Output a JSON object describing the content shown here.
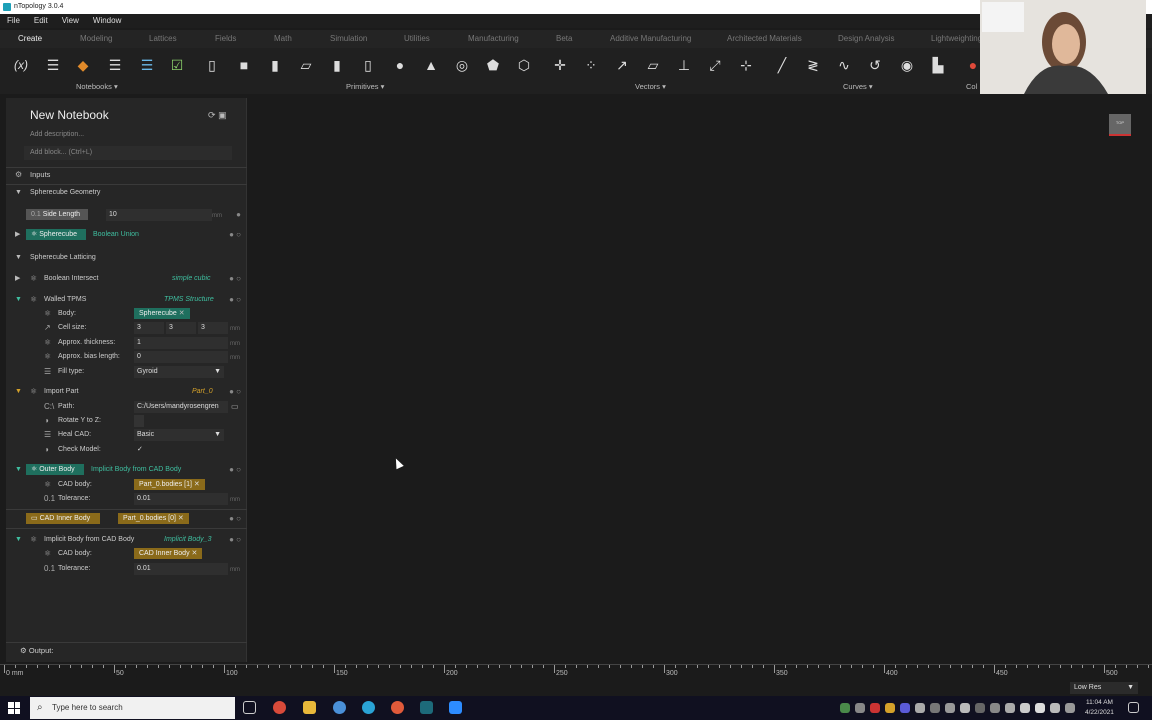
{
  "window": {
    "title": "nTopology 3.0.4"
  },
  "menu": [
    "File",
    "Edit",
    "View",
    "Window"
  ],
  "tabs": [
    "Create",
    "Modeling",
    "Lattices",
    "Fields",
    "Math",
    "Simulation",
    "Utilities",
    "Manufacturing",
    "Beta",
    "Additive Manufacturing",
    "Architected Materials",
    "Design Analysis",
    "Lightweighting"
  ],
  "ribbon": {
    "groups": [
      "Notebooks",
      "Primitives",
      "Vectors",
      "Curves",
      "Col"
    ],
    "fx_label": "(x)"
  },
  "notebook": {
    "title": "New Notebook",
    "description_placeholder": "Add description...",
    "add_block_placeholder": "Add block... (Ctrl+L)",
    "inputs_label": "Inputs",
    "output_label": "Output:"
  },
  "sections": {
    "geometry": {
      "title": "Spherecube Geometry",
      "side_length": {
        "label": "Side Length",
        "value": "10",
        "unit": "mm"
      },
      "spherecube": {
        "label": "Spherecube",
        "type": "Boolean Union"
      }
    },
    "latticing": {
      "title": "Spherecube Latticing",
      "boolean_intersect": {
        "label": "Boolean Intersect",
        "subtitle": "simple cubic"
      },
      "walled_tpms": {
        "label": "Walled TPMS",
        "subtitle": "TPMS Structure",
        "body_label": "Body:",
        "body_value": "Spherecube",
        "cell_size_label": "Cell size:",
        "cell_size": [
          "3",
          "3",
          "3"
        ],
        "cell_unit": "mm",
        "thickness_label": "Approx. thickness:",
        "thickness": "1",
        "bias_label": "Approx. bias length:",
        "bias": "0",
        "fill_label": "Fill type:",
        "fill": "Gyroid",
        "unit": "mm"
      },
      "import_part": {
        "label": "Import Part",
        "subtitle": "Part_0",
        "path_label": "Path:",
        "path": "C:/Users/mandyrosengren",
        "rotate_label": "Rotate Y to Z:",
        "heal_label": "Heal CAD:",
        "heal": "Basic",
        "check_label": "Check Model:",
        "check": "✓"
      },
      "outer_body": {
        "label": "Outer Body",
        "type": "Implicit Body from CAD Body",
        "cad_label": "CAD body:",
        "cad_value": "Part_0.bodies [1]",
        "tol_label": "Tolerance:",
        "tol": "0.01",
        "unit": "mm"
      },
      "cad_inner": {
        "label": "CAD Inner Body",
        "value": "Part_0.bodies [0]"
      },
      "implicit": {
        "label": "Implicit Body from CAD Body",
        "subtitle": "Implicit Body_3",
        "cad_label": "CAD body:",
        "cad_value": "CAD Inner Body",
        "tol_label": "Tolerance:",
        "tol": "0.01",
        "unit": "mm"
      }
    }
  },
  "viewport": {
    "cube_label": "TOP"
  },
  "ruler": {
    "labels": [
      "0 mm",
      "50",
      "100",
      "150",
      "200",
      "250",
      "300",
      "350",
      "400",
      "450",
      "500"
    ]
  },
  "status": {
    "resolution": "Low Res"
  },
  "taskbar": {
    "search_placeholder": "Type here to search",
    "time": "11:04 AM",
    "date": "4/22/2021"
  },
  "colors": {
    "teal": "#3fbfa0",
    "gold": "#d4a12a",
    "accent": "#2aa3d6"
  }
}
